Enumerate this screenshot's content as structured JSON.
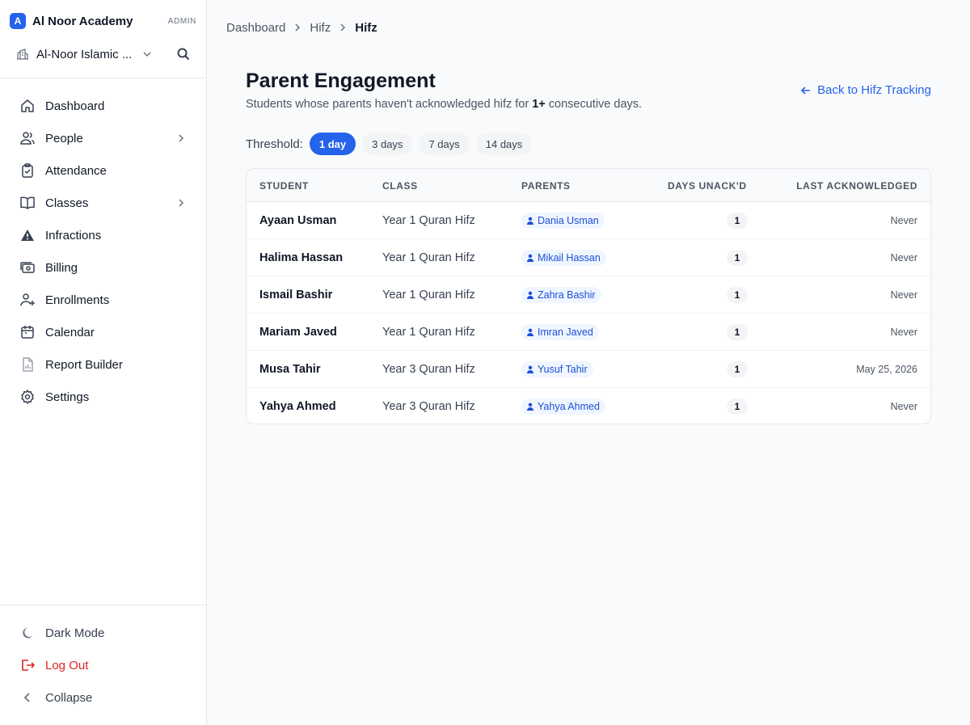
{
  "brand": {
    "logo_letter": "A",
    "name": "Al Noor Academy",
    "role": "ADMIN"
  },
  "school": {
    "name": "Al-Noor Islamic ..."
  },
  "nav": {
    "items": [
      {
        "label": "Dashboard",
        "icon": "home-icon"
      },
      {
        "label": "People",
        "icon": "users-icon",
        "has_submenu": true
      },
      {
        "label": "Attendance",
        "icon": "clipboard-check-icon"
      },
      {
        "label": "Classes",
        "icon": "book-open-icon",
        "has_submenu": true
      },
      {
        "label": "Infractions",
        "icon": "warning-icon"
      },
      {
        "label": "Billing",
        "icon": "money-icon"
      },
      {
        "label": "Enrollments",
        "icon": "user-plus-icon"
      },
      {
        "label": "Calendar",
        "icon": "calendar-icon"
      },
      {
        "label": "Report Builder",
        "icon": "report-icon"
      },
      {
        "label": "Settings",
        "icon": "gear-icon"
      }
    ],
    "bottom": [
      {
        "label": "Dark Mode",
        "icon": "moon-icon"
      },
      {
        "label": "Log Out",
        "icon": "logout-icon"
      },
      {
        "label": "Collapse",
        "icon": "chevron-left-icon"
      }
    ]
  },
  "breadcrumb": [
    "Dashboard",
    "Hifz",
    "Hifz"
  ],
  "page": {
    "title": "Parent Engagement",
    "subtitle_before": "Students whose parents haven't acknowledged hifz for ",
    "subtitle_bold": "1+",
    "subtitle_after": " consecutive days.",
    "back_link": "Back to Hifz Tracking"
  },
  "threshold": {
    "label": "Threshold:",
    "options": [
      "1 day",
      "3 days",
      "7 days",
      "14 days"
    ],
    "selected": "1 day"
  },
  "table": {
    "headers": [
      "STUDENT",
      "CLASS",
      "PARENTS",
      "DAYS UNACK'D",
      "LAST ACKNOWLEDGED"
    ],
    "rows": [
      {
        "student": "Ayaan Usman",
        "class": "Year 1 Quran Hifz",
        "parent": "Dania Usman",
        "days": "1",
        "last": "Never"
      },
      {
        "student": "Halima Hassan",
        "class": "Year 1 Quran Hifz",
        "parent": "Mikail Hassan",
        "days": "1",
        "last": "Never"
      },
      {
        "student": "Ismail Bashir",
        "class": "Year 1 Quran Hifz",
        "parent": "Zahra Bashir",
        "days": "1",
        "last": "Never"
      },
      {
        "student": "Mariam Javed",
        "class": "Year 1 Quran Hifz",
        "parent": "Imran Javed",
        "days": "1",
        "last": "Never"
      },
      {
        "student": "Musa Tahir",
        "class": "Year 3 Quran Hifz",
        "parent": "Yusuf Tahir",
        "days": "1",
        "last": "May 25, 2026"
      },
      {
        "student": "Yahya Ahmed",
        "class": "Year 3 Quran Hifz",
        "parent": "Yahya Ahmed",
        "days": "1",
        "last": "Never"
      }
    ]
  },
  "colors": {
    "accent": "#2563eb",
    "danger": "#dc2626",
    "chip_bg": "#eff6ff",
    "background": "#f9fafb"
  }
}
